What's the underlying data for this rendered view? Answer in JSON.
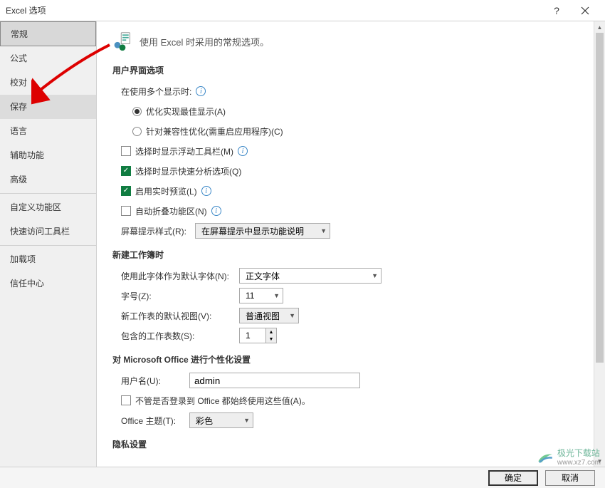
{
  "titlebar": {
    "title": "Excel 选项"
  },
  "sidebar": {
    "items": [
      {
        "label": "常规",
        "name": "sidebar-item-general",
        "selected": true
      },
      {
        "label": "公式",
        "name": "sidebar-item-formulas"
      },
      {
        "label": "校对",
        "name": "sidebar-item-proofing"
      },
      {
        "label": "保存",
        "name": "sidebar-item-save",
        "hover": true
      },
      {
        "label": "语言",
        "name": "sidebar-item-language"
      },
      {
        "label": "辅助功能",
        "name": "sidebar-item-accessibility"
      },
      {
        "label": "高级",
        "name": "sidebar-item-advanced"
      }
    ],
    "group2": [
      {
        "label": "自定义功能区",
        "name": "sidebar-item-customize-ribbon"
      },
      {
        "label": "快速访问工具栏",
        "name": "sidebar-item-quick-access"
      }
    ],
    "group3": [
      {
        "label": "加载项",
        "name": "sidebar-item-addins"
      },
      {
        "label": "信任中心",
        "name": "sidebar-item-trust-center"
      }
    ]
  },
  "header": {
    "text": "使用 Excel 时采用的常规选项。"
  },
  "sections": {
    "ui": {
      "title": "用户界面选项",
      "multi_display_label": "在使用多个显示时:",
      "radio_optimize": "优化实现最佳显示(A)",
      "radio_compat": "针对兼容性优化(需重启应用程序)(C)",
      "cb_float_toolbar": "选择时显示浮动工具栏(M)",
      "cb_quick_analysis": "选择时显示快速分析选项(Q)",
      "cb_live_preview": "启用实时预览(L)",
      "cb_collapse_ribbon": "自动折叠功能区(N)",
      "screentip_label": "屏幕提示样式(R):",
      "screentip_value": "在屏幕提示中显示功能说明"
    },
    "newwb": {
      "title": "新建工作簿时",
      "font_label": "使用此字体作为默认字体(N):",
      "font_value": "正文字体",
      "size_label": "字号(Z):",
      "size_value": "11",
      "view_label": "新工作表的默认视图(V):",
      "view_value": "普通视图",
      "sheets_label": "包含的工作表数(S):",
      "sheets_value": "1"
    },
    "personalize": {
      "title": "对 Microsoft Office 进行个性化设置",
      "username_label": "用户名(U):",
      "username_value": "admin",
      "cb_always_use": "不管是否登录到 Office 都始终使用这些值(A)。",
      "theme_label": "Office 主题(T):",
      "theme_value": "彩色"
    },
    "privacy": {
      "title": "隐私设置"
    }
  },
  "footer": {
    "ok": "确定",
    "cancel": "取消"
  },
  "watermark": {
    "text": "极光下载站",
    "url": "www.xz7.com"
  }
}
